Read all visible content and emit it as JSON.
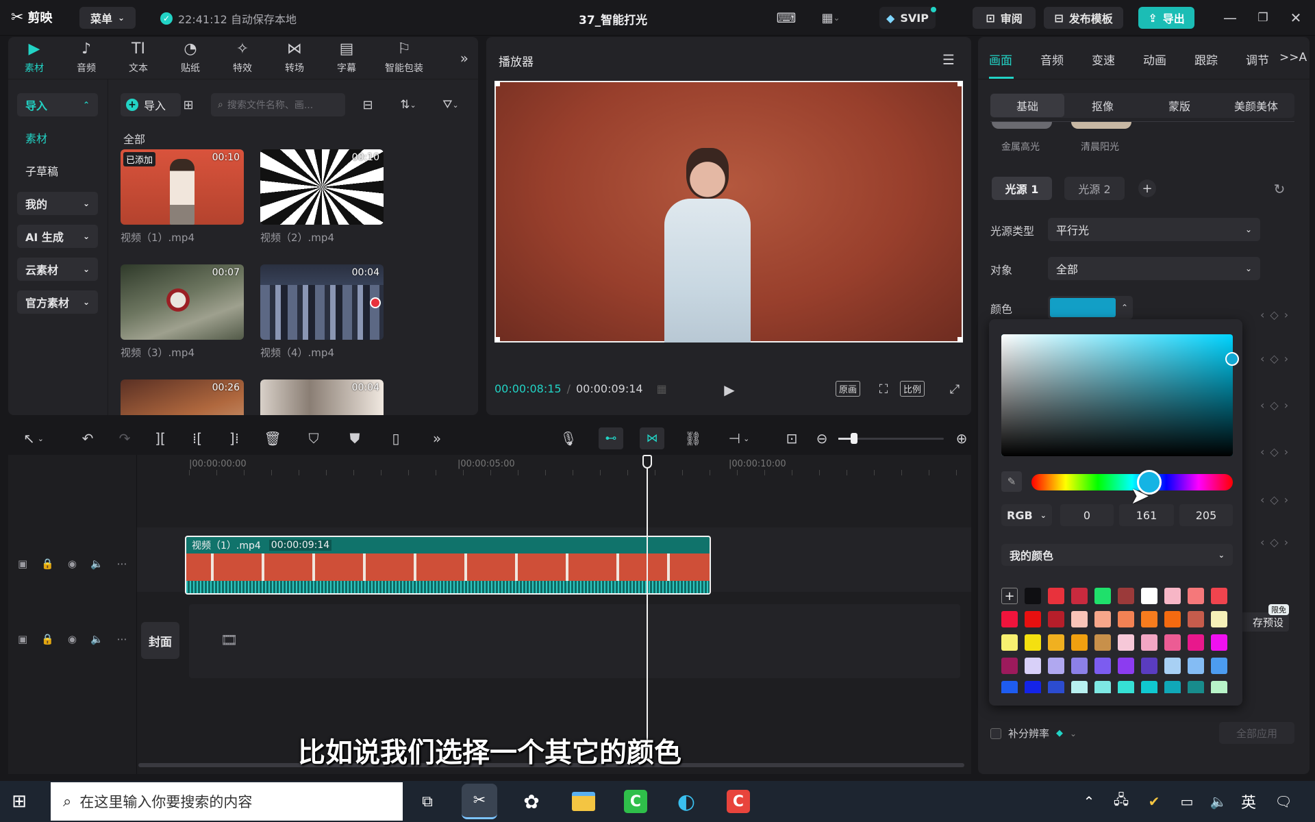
{
  "titlebar": {
    "logo": "剪映",
    "menu_label": "菜单",
    "autosave": "22:41:12 自动保存本地",
    "project_title": "37_智能打光",
    "svip": "SVIP",
    "review": "审阅",
    "publish_template": "发布模板",
    "export": "导出"
  },
  "media_tabs": [
    {
      "label": "素材",
      "icon": "▶"
    },
    {
      "label": "音频",
      "icon": "♪"
    },
    {
      "label": "文本",
      "icon": "TI"
    },
    {
      "label": "贴纸",
      "icon": "◔"
    },
    {
      "label": "特效",
      "icon": "✧"
    },
    {
      "label": "转场",
      "icon": "⋈"
    },
    {
      "label": "字幕",
      "icon": "▤"
    },
    {
      "label": "智能包装",
      "icon": "⚐"
    }
  ],
  "sidebar": {
    "import": "导入",
    "material": "素材",
    "sub_draft": "子草稿",
    "mine": "我的",
    "ai_gen": "AI 生成",
    "cloud": "云素材",
    "official": "官方素材"
  },
  "media_toolbar": {
    "import_button": "导入",
    "search_placeholder": "搜索文件名称、画..."
  },
  "media_section_title": "全部",
  "media_items": [
    {
      "label": "视频（1）.mp4",
      "duration": "00:10",
      "badge": "已添加"
    },
    {
      "label": "视频（2）.mp4",
      "duration": "00:10"
    },
    {
      "label": "视频（3）.mp4",
      "duration": "00:07"
    },
    {
      "label": "视频（4）.mp4",
      "duration": "00:04"
    },
    {
      "label": "",
      "duration": "00:26"
    },
    {
      "label": "",
      "duration": "00:04"
    }
  ],
  "player": {
    "title": "播放器",
    "current_time": "00:00:08:15",
    "total_time": "00:00:09:14",
    "original_btn": "原画",
    "ratio_btn": "比例"
  },
  "props": {
    "tabs": [
      "画面",
      "音频",
      "变速",
      "动画",
      "跟踪",
      "调节"
    ],
    "more": ">>A",
    "subtabs": [
      "基础",
      "抠像",
      "蒙版",
      "美颜美体"
    ],
    "presets": [
      "金属高光",
      "清晨阳光"
    ],
    "light1": "光源 1",
    "light2": "光源 2",
    "light_type_label": "光源类型",
    "light_type_value": "平行光",
    "target_label": "对象",
    "target_value": "全部",
    "color_label": "颜色",
    "color_value": "#129fc6",
    "save_preset": "存预设",
    "limited_free": "限免",
    "supplement_res": "补分辨率",
    "apply_all": "全部应用"
  },
  "color_picker": {
    "mode": "RGB",
    "r": "0",
    "g": "161",
    "b": "205",
    "my_colors": "我的颜色",
    "hue_color": "#00d4ff",
    "swatches": [
      "add",
      "#0f0f12",
      "#e8323c",
      "#c92a3e",
      "#1fe06b",
      "#9b3a3a",
      "#ffffff",
      "#f7b6c6",
      "#f5787a",
      "#f0444e",
      "#f0143c",
      "#e81010",
      "#b61e2a",
      "#f9c4b8",
      "#f7a68a",
      "#f28254",
      "#f77c1e",
      "#f46a10",
      "#c65c4c",
      "#f5f0b8",
      "#f8f070",
      "#f4e010",
      "#f0b020",
      "#f0a010",
      "#c8904a",
      "#f6c8d8",
      "#f2a6c4",
      "#ec5c94",
      "#e8188c",
      "#f010f0",
      "#9c1a5c",
      "#d8d0f8",
      "#b0a8f0",
      "#8c80e8",
      "#7c5cf0",
      "#8c3cf0",
      "#5a3cc0",
      "#a8d0f4",
      "#84bcf4",
      "#4c9cf0",
      "#1e5cf0",
      "#1424e8",
      "#2c4cd0",
      "#b8f0f0",
      "#7ee8e4",
      "#36e0d4",
      "#10c8d0",
      "#10a8b8",
      "#188c8c",
      "#b8f4c8"
    ]
  },
  "timeline": {
    "ticks": [
      "|00:00:00:00",
      "|00:00:05:00",
      "|00:00:10:00"
    ],
    "clip_name": "视频（1）.mp4",
    "clip_duration": "00:00:09:14",
    "cover": "封面"
  },
  "subtitle": "比如说我们选择一个其它的颜色",
  "taskbar": {
    "search_placeholder": "在这里输入你要搜索的内容",
    "ime": "英"
  }
}
